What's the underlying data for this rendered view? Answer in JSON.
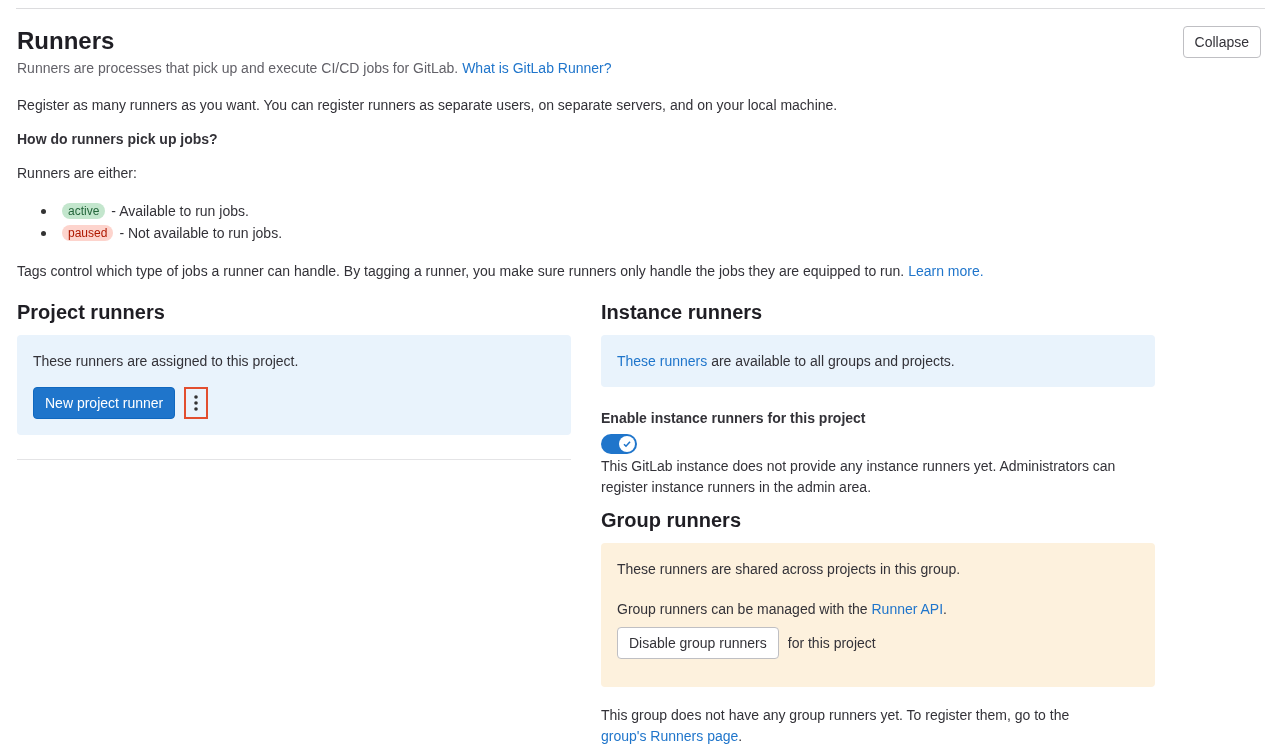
{
  "section": {
    "title": "Runners",
    "collapse_button": "Collapse",
    "intro": [
      {
        "text": "Runners are processes that pick up and execute CI/CD jobs for GitLab. "
      },
      {
        "link": "What is GitLab Runner?"
      }
    ],
    "register_text": "Register as many runners as you want. You can register runners as separate users, on separate servers, and on your local machine.",
    "question": "How do runners pick up jobs?",
    "either_text": "Runners are either:",
    "states": [
      {
        "badge": "active",
        "kind": "active",
        "description": "- Available to run jobs."
      },
      {
        "badge": "paused",
        "kind": "paused",
        "description": "- Not available to run jobs."
      }
    ],
    "tags_text": [
      {
        "text": "Tags control which type of jobs a runner can handle. By tagging a runner, you make sure runners only handle the jobs they are equipped to run. "
      },
      {
        "link": "Learn more."
      }
    ]
  },
  "project_runners": {
    "title": "Project runners",
    "info": "These runners are assigned to this project.",
    "new_button": "New project runner",
    "more_actions_highlighted": true
  },
  "instance_runners": {
    "title": "Instance runners",
    "info": [
      {
        "link": "These runners"
      },
      {
        "text": " are available to all groups and projects."
      }
    ],
    "toggle_label": "Enable instance runners for this project",
    "toggle_on": true,
    "note": "This GitLab instance does not provide any instance runners yet. Administrators can register instance runners in the admin area."
  },
  "group_runners": {
    "title": "Group runners",
    "info": "These runners are shared across projects in this group.",
    "api_text": [
      {
        "text": "Group runners can be managed with the "
      },
      {
        "link": "Runner API"
      },
      {
        "text": "."
      }
    ],
    "disable_button": "Disable group runners",
    "disable_suffix": "for this project",
    "note": [
      {
        "text": "This group does not have any group runners yet. To register them, go to the "
      },
      {
        "link": "group's Runners page"
      },
      {
        "text": "."
      }
    ]
  }
}
